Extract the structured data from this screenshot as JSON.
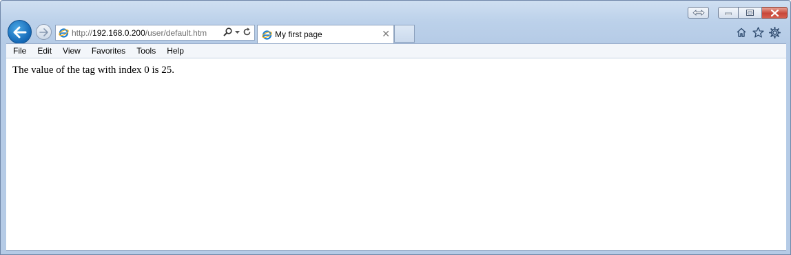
{
  "window": {
    "address": {
      "scheme": "http://",
      "host": "192.168.0.200",
      "path": "/user/default.htm"
    },
    "tabs": [
      {
        "title": "My first page",
        "active": true
      }
    ]
  },
  "menu": {
    "items": [
      "File",
      "Edit",
      "View",
      "Favorites",
      "Tools",
      "Help"
    ]
  },
  "content": {
    "text": "The value of the tag with index 0 is 25."
  },
  "colors": {
    "frame": "#b9cfe9",
    "back_button": "#1467b5",
    "close_button": "#c8473a"
  },
  "icons": {
    "back": "arrow-left-icon",
    "forward": "arrow-right-icon",
    "search": "search-icon",
    "refresh": "refresh-icon",
    "home": "home-icon",
    "favorites": "star-icon",
    "tools": "gear-icon",
    "site": "ie-logo-icon"
  }
}
